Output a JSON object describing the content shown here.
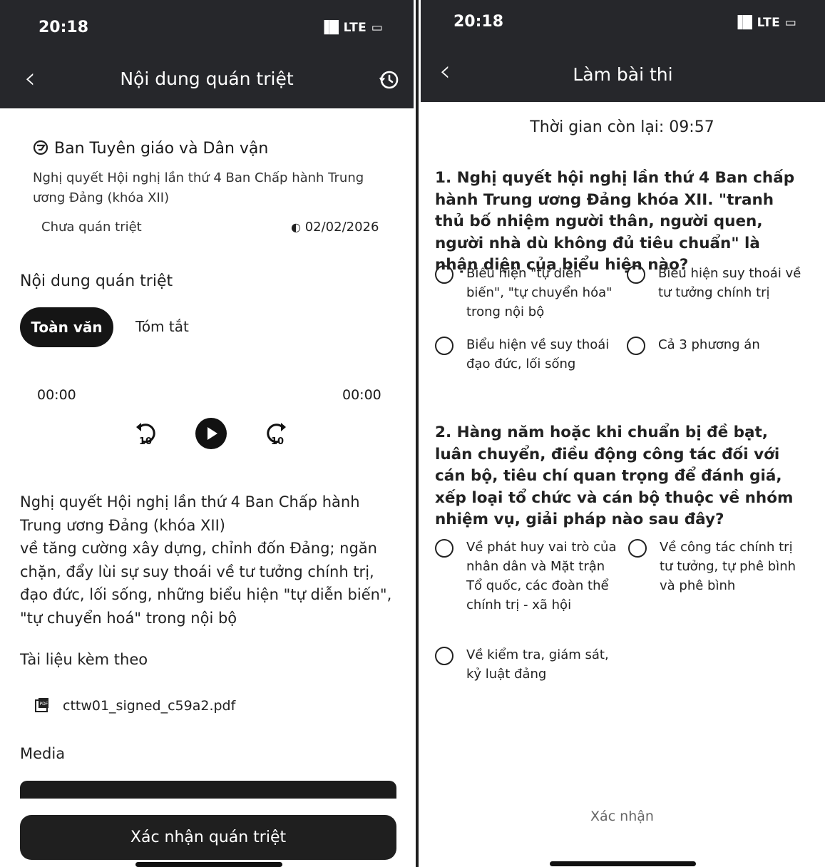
{
  "left": {
    "status_time": "20:18",
    "status_icons": "▐█ LTE ▭",
    "nav_title": "Nội dung quán triệt",
    "org_name": "Ban Tuyên giáo và Dân vận",
    "doc_subtitle": "Nghị quyết Hội nghị lần thứ 4 Ban Chấp hành Trung ương Đảng (khóa XII)",
    "status": "Chưa quán triệt",
    "date": "02/02/2026",
    "section_title": "Nội dung quán triệt",
    "tabs": [
      "Toàn văn",
      "Tóm tắt"
    ],
    "audio": {
      "current": "00:00",
      "total": "00:00"
    },
    "body_lines": [
      "Nghị quyết Hội nghị lần thứ 4 Ban Chấp hành",
      "Trung ương Đảng (khóa XII)",
      "về tăng cường xây dựng, chỉnh đốn Đảng; ngăn",
      "chặn, đẩy lùi sự suy thoái về tư tưởng chính trị,",
      "đạo đức, lối sống, những biểu hiện \"tự diễn biến\",",
      "\"tự chuyển hoá\" trong nội bộ"
    ],
    "attachments_title": "Tài liệu kèm theo",
    "attachment_file": "cttw01_signed_c59a2.pdf",
    "media_title": "Media",
    "confirm_button": "Xác nhận quán triệt"
  },
  "right": {
    "status_time": "20:18",
    "status_icons": "▐█ LTE ▭",
    "nav_title": "Làm bài thi",
    "timer_label": "Thời gian còn lại: 09:57",
    "questions": [
      {
        "text": "1. Nghị quyết hội nghị lần thứ 4 Ban chấp hành Trung ương Đảng khóa XII. \"tranh thủ bố nhiệm người thân, người quen, người nhà dù không đủ tiêu chuẩn\"  là nhận diện của biểu hiện nào?",
        "options": [
          "Biểu hiện \"tự diễn biến\", \"tự chuyển hóa\" trong nội bộ",
          "Biểu hiện suy thoái về tư tưởng chính trị",
          "Biểu hiện về suy thoái đạo đức, lối sống",
          "Cả 3 phương án"
        ]
      },
      {
        "text": "2. Hàng năm hoặc khi chuẩn bị đề bạt, luân chuyển, điều động công tác đối với cán bộ, tiêu chí quan trọng để đánh giá, xếp loại tổ chức và cán bộ thuộc về nhóm nhiệm vụ, giải pháp nào sau đây?",
        "options": [
          "Về phát huy vai trò của nhân dân và Mặt trận Tổ quốc, các đoàn thể chính trị - xã hội",
          "Về công tác chính trị tư tưởng, tự phê bình và phê bình",
          "Về kiểm tra, giám sát, kỷ luật đảng"
        ]
      }
    ],
    "submit_label": "Xác nhận"
  }
}
